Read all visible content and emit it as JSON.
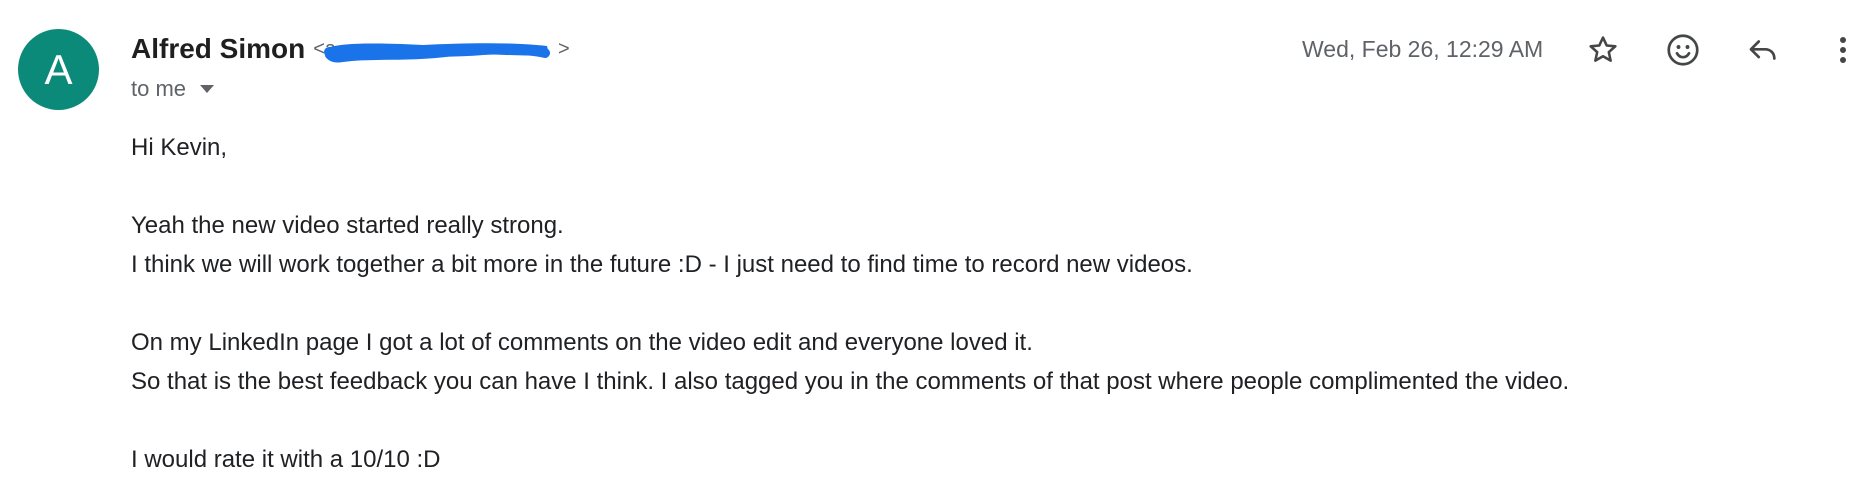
{
  "email": {
    "avatar_letter": "A",
    "avatar_color": "#0b8a7a",
    "sender_name": "Alfred Simon",
    "sender_email_open": "<a",
    "sender_email_close": ">",
    "redaction_color": "#1a73e8",
    "recipient": "to me",
    "date": "Wed, Feb 26, 12:29 AM",
    "actions": {
      "star_icon": "star-outline-icon",
      "emoji_icon": "emoji-reaction-icon",
      "reply_icon": "reply-icon",
      "more_icon": "more-vert-icon"
    },
    "body": {
      "greeting": "Hi Kevin,",
      "line1": "Yeah the new video started really strong.",
      "line2": "I think we will work together a bit more in the future :D - I just need to find time to record new videos.",
      "line3": "On my LinkedIn page I got a lot of comments on the video edit and everyone loved it.",
      "line4": "So that is the best feedback you can have I think. I also tagged you in the comments of that post where people complimented the video.",
      "line5": "I would rate it with a 10/10 :D"
    }
  }
}
